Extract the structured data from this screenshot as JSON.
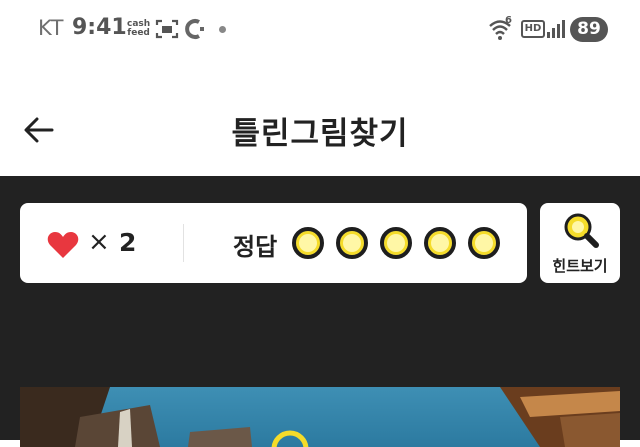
{
  "status_bar": {
    "carrier": "KT",
    "time": "9:41",
    "app_badge": [
      "cash",
      "feed"
    ],
    "network_badge": "6",
    "hd_badge": "HD",
    "battery": "89"
  },
  "header": {
    "title": "틀린그림찾기"
  },
  "game": {
    "lives_symbol": "×",
    "lives": "2",
    "answer_label": "정답",
    "answers_found": 0,
    "answers_total": 5,
    "hint_label": "힌트보기"
  },
  "colors": {
    "dark_bg": "#222222",
    "heart": "#e8373f",
    "slot_fill": "#fff7a6",
    "slot_ring": "#f5dc2a",
    "sky": "#2c7aa0"
  }
}
